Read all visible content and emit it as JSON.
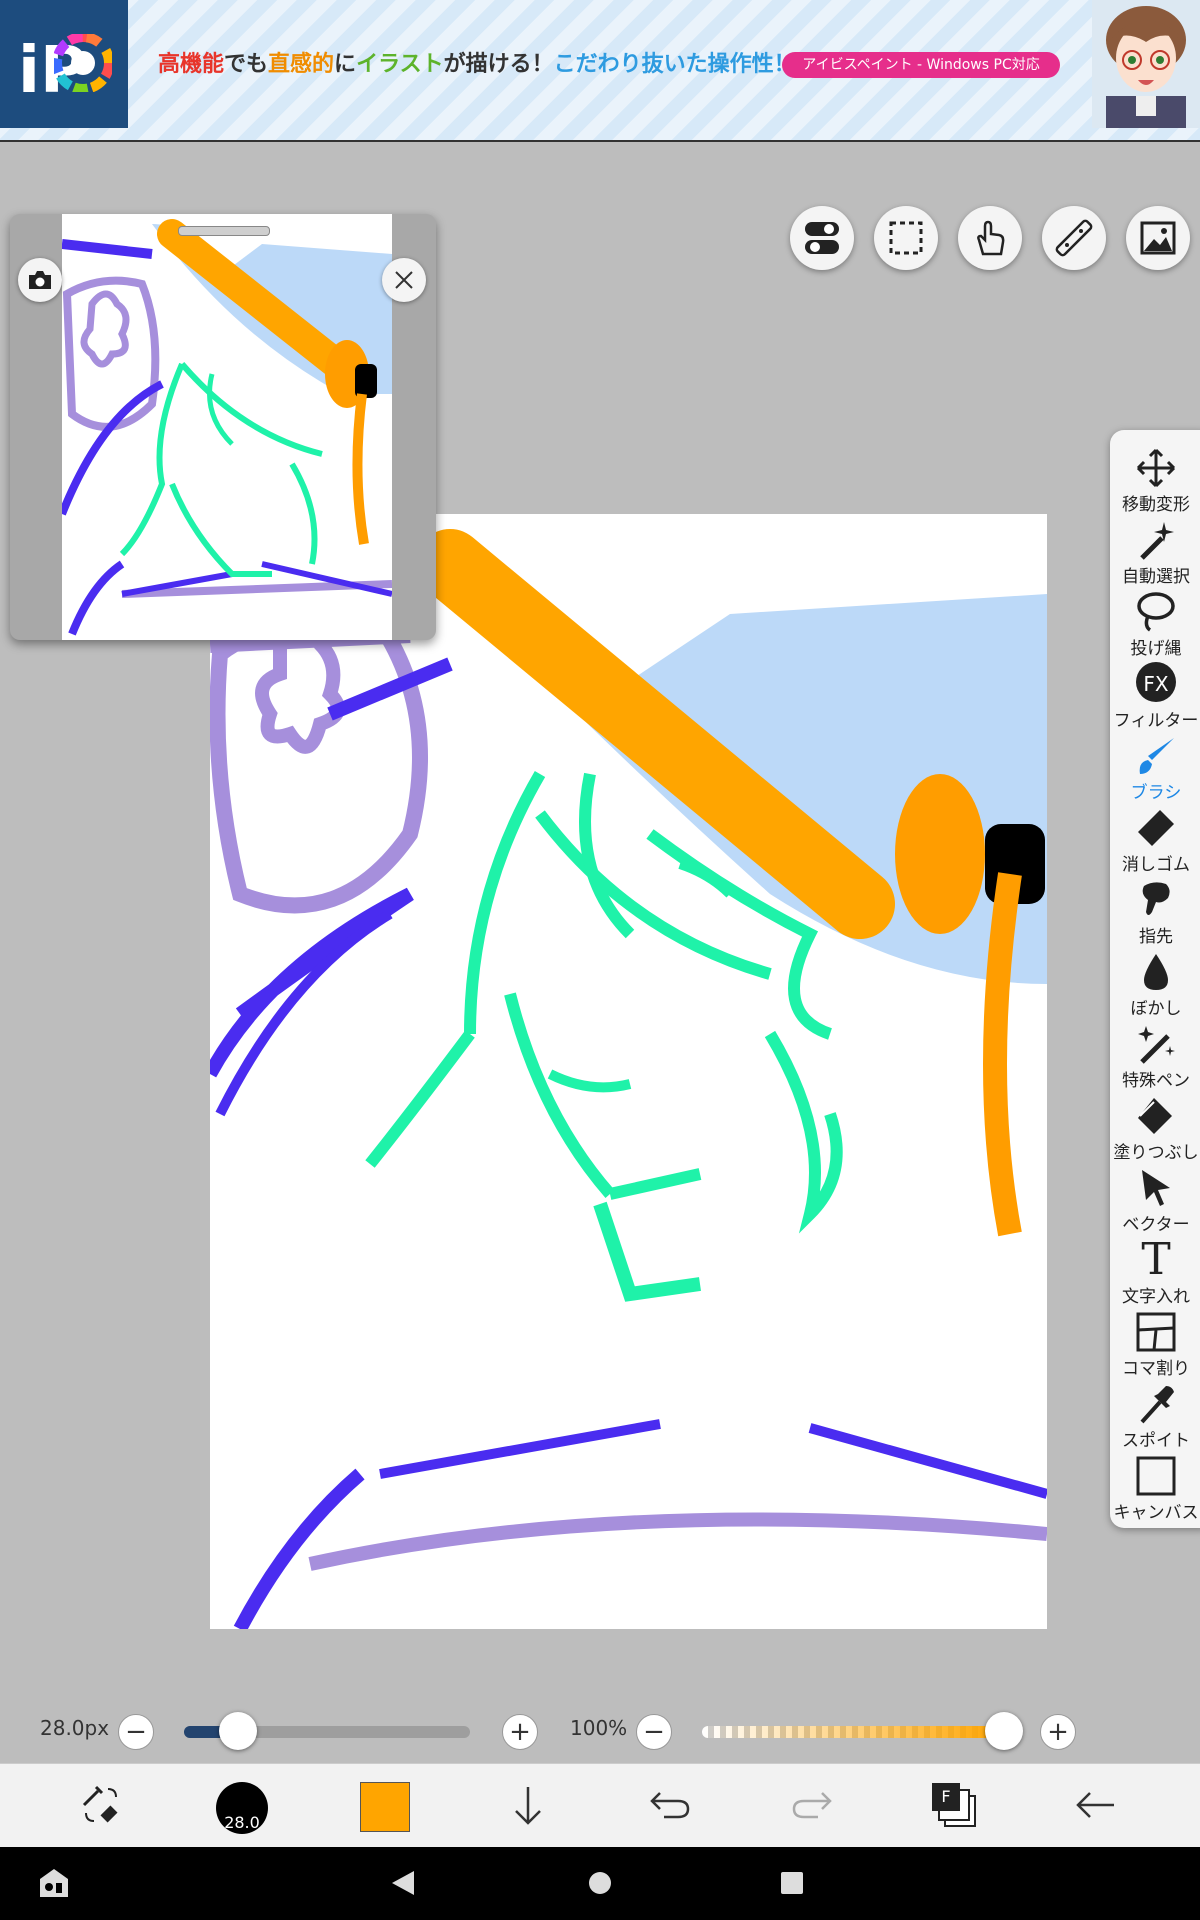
{
  "banner": {
    "logo_text": "iP",
    "headline_parts": [
      {
        "text": "高機能",
        "color": "#e8342a"
      },
      {
        "text": "でも",
        "color": "#333333"
      },
      {
        "text": "直感的",
        "color": "#f08c00"
      },
      {
        "text": "に",
        "color": "#333333"
      },
      {
        "text": "イラスト",
        "color": "#5db32b"
      },
      {
        "text": "が描ける！",
        "color": "#333333"
      },
      {
        "text": "こだわり抜いた操作性！",
        "color": "#2e9be0"
      }
    ],
    "pill_text": "アイビスペイント - Windows PC対応"
  },
  "top_buttons": [
    {
      "name": "toggle-icon"
    },
    {
      "name": "selection-icon"
    },
    {
      "name": "hand-icon"
    },
    {
      "name": "ruler-icon"
    },
    {
      "name": "image-icon"
    }
  ],
  "toolbar": {
    "items": [
      {
        "label": "移動変形",
        "icon": "move-icon"
      },
      {
        "label": "自動選択",
        "icon": "magic-wand-icon"
      },
      {
        "label": "投げ縄",
        "icon": "lasso-icon"
      },
      {
        "label": "フィルター",
        "icon": "fx-icon"
      },
      {
        "label": "ブラシ",
        "icon": "brush-icon",
        "active": true
      },
      {
        "label": "消しゴム",
        "icon": "eraser-icon"
      },
      {
        "label": "指先",
        "icon": "finger-icon"
      },
      {
        "label": "ぼかし",
        "icon": "blur-icon"
      },
      {
        "label": "特殊ペン",
        "icon": "special-pen-icon"
      },
      {
        "label": "塗りつぶし",
        "icon": "fill-icon"
      },
      {
        "label": "ベクター",
        "icon": "vector-icon"
      },
      {
        "label": "文字入れ",
        "icon": "text-icon"
      },
      {
        "label": "コマ割り",
        "icon": "frame-icon"
      },
      {
        "label": "スポイト",
        "icon": "eyedropper-icon"
      },
      {
        "label": "キャンバス",
        "icon": "canvas-icon"
      }
    ],
    "fx_text": "FX",
    "text_glyph": "T"
  },
  "brush": {
    "size_label": "28.0px",
    "size_fraction": 0.19,
    "preview_text": "28.0",
    "minus": "−",
    "plus": "+"
  },
  "opacity": {
    "label": "100%",
    "fraction": 1.0
  },
  "colors": {
    "primary": "#ffa500",
    "accent_blue": "#1e88e5"
  },
  "bottom": {
    "layer_badge": "F"
  }
}
